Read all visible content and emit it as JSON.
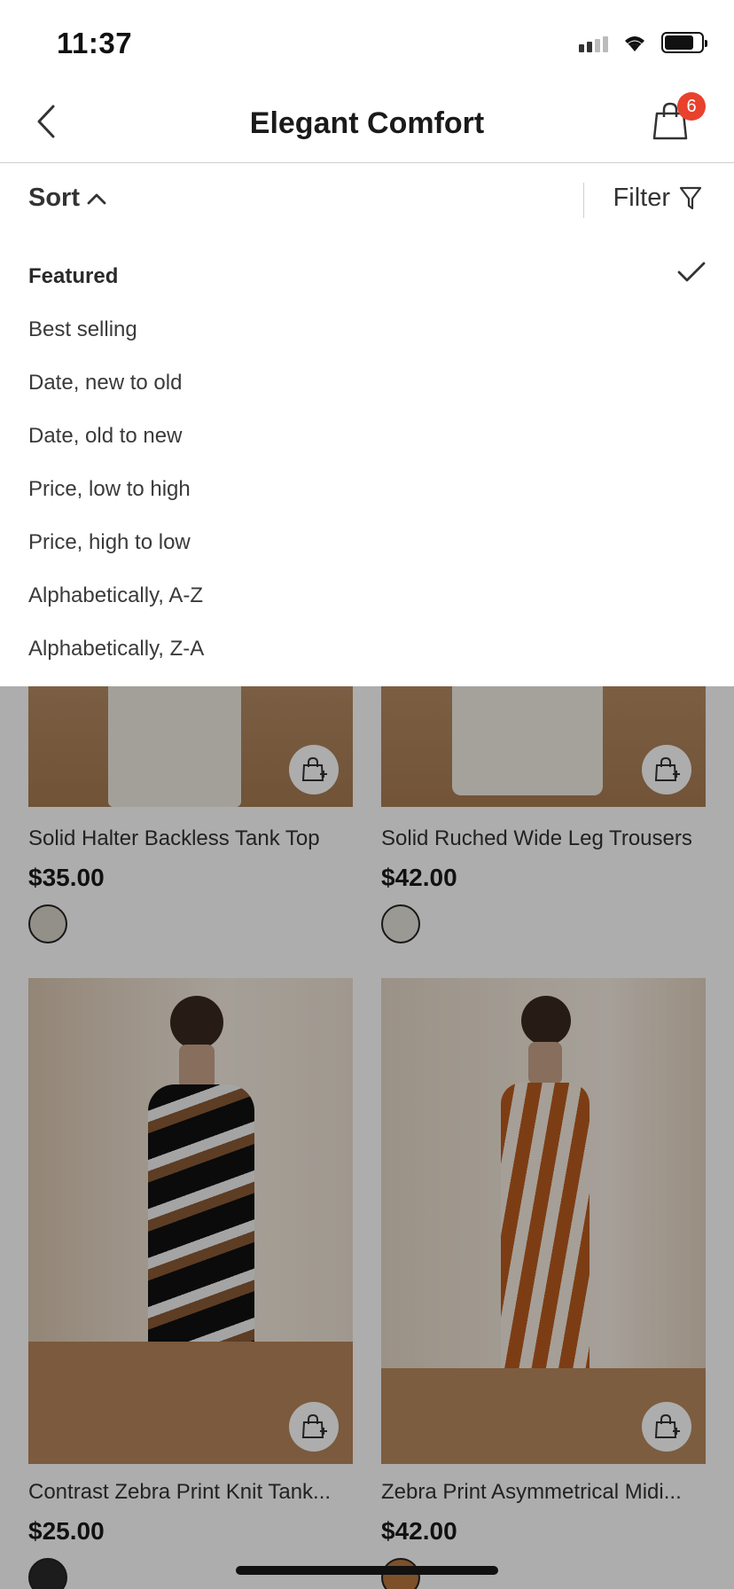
{
  "status_bar": {
    "time": "11:37"
  },
  "header": {
    "title": "Elegant Comfort",
    "cart_count": "6"
  },
  "toolbar": {
    "sort_label": "Sort",
    "filter_label": "Filter"
  },
  "sort_menu": {
    "selected_index": 0,
    "options": [
      "Featured",
      "Best selling",
      "Date, new to old",
      "Date, old to new",
      "Price, low to high",
      "Price, high to low",
      "Alphabetically, A-Z",
      "Alphabetically, Z-A"
    ]
  },
  "products": [
    {
      "name": "Solid Halter Backless Tank Top",
      "price": "$35.00"
    },
    {
      "name": "Solid Ruched Wide Leg Trousers",
      "price": "$42.00"
    },
    {
      "name": "Contrast Zebra Print Knit Tank...",
      "price": "$25.00"
    },
    {
      "name": "Zebra Print Asymmetrical Midi...",
      "price": "$42.00"
    }
  ],
  "colors": {
    "badge": "#e8412d",
    "accent": "#1a1a1a"
  }
}
